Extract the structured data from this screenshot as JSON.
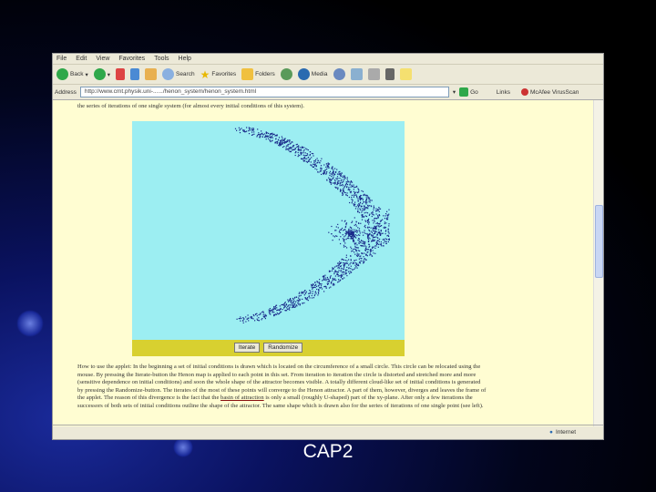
{
  "browser": {
    "menu": [
      "File",
      "Edit",
      "View",
      "Favorites",
      "Tools",
      "Help"
    ],
    "toolbar": {
      "back": "Back",
      "search": "Search",
      "favorites": "Favorites",
      "folders": "Folders",
      "media": "Media"
    },
    "address_label": "Address",
    "address_value": "http://www.cmt.physik.uni-....../henon_system/henon_system.html",
    "go": "Go",
    "links": "Links",
    "links_item": "McAfee VirusScan",
    "status_zone": "Internet"
  },
  "page": {
    "intro": "the series of iterations of one single system (for almost every initial conditions of this system).",
    "applet_buttons": [
      "Iterate",
      "Randomize"
    ],
    "para_start": "How to use the applet: In the beginning a set of initial conditions is drawn which is located on the circumference of a small circle. This circle can be relocated using the mouse. By pressing the Iterate-button the Henon map is applied to each point in this set. From iteration to iteration the circle is distorted and stretched more and more (sensitive dependence on initial conditions) and soon the whole shape of the attractor becomes visible. A totally different cloud-like set of initial conditions is generated by pressing the Randomize-button. The iterates of the most of these points will converge to the Henon attractor. A part of them, however, diverges and leaves the frame of the applet. The reason of this divergence is the fact that the ",
    "link": "basin of attraction",
    "para_end": " is only a small (roughly U-shaped) part of the xy-plane. After only a few iterations the successors of both sets of initial conditions outline the shape of the attractor. The same shape which is drawn also for the series of iterations of one single point (see left)."
  },
  "slide_caption": "CAP2"
}
